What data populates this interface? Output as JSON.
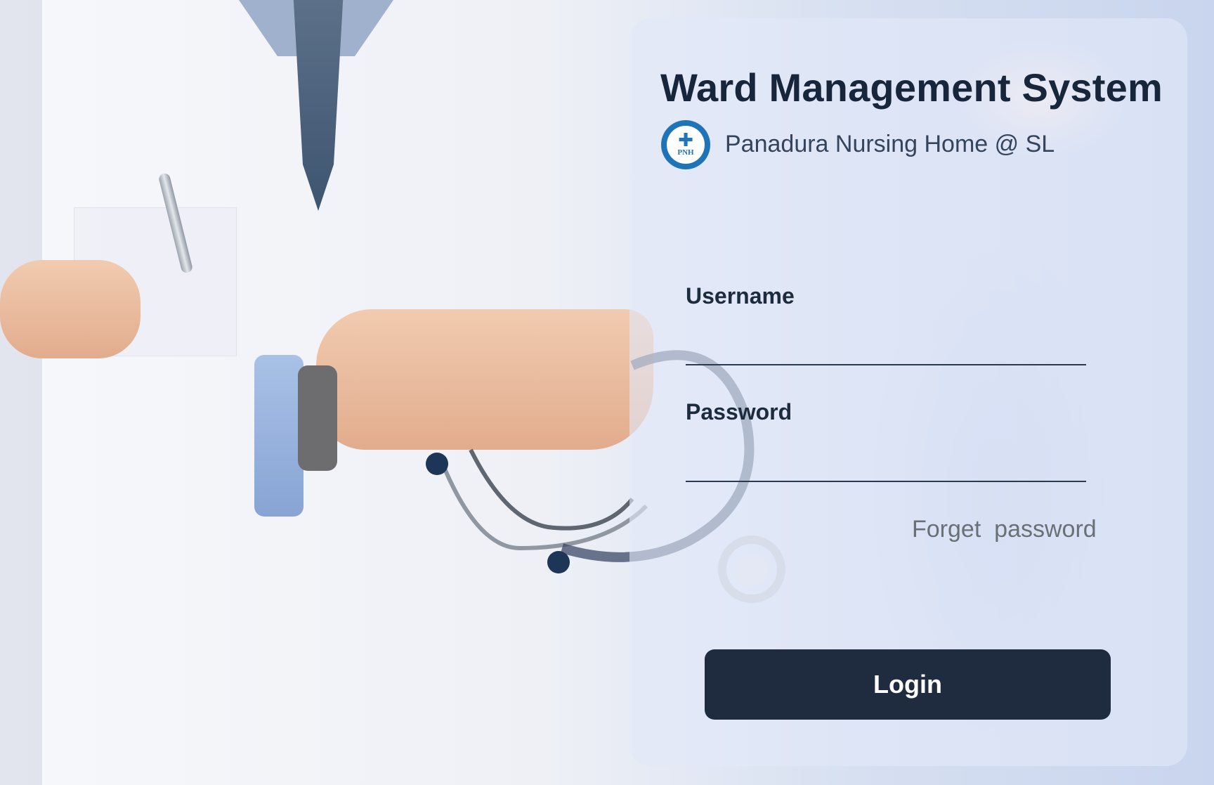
{
  "app": {
    "title": "Ward Management System",
    "subtitle": "Panadura Nursing Home @ SL",
    "logo_text": "PNH",
    "logo_icon": "medical-cross-icon"
  },
  "login_form": {
    "username_label": "Username",
    "username_value": "",
    "password_label": "Password",
    "password_value": "",
    "forget_password_label": "Forget  password",
    "login_button_label": "Login"
  },
  "colors": {
    "panel_text": "#18263b",
    "button_bg": "#1f2b3e",
    "button_text": "#ffffff",
    "link_text": "#6b6f76",
    "logo_blue": "#1f73b7"
  }
}
